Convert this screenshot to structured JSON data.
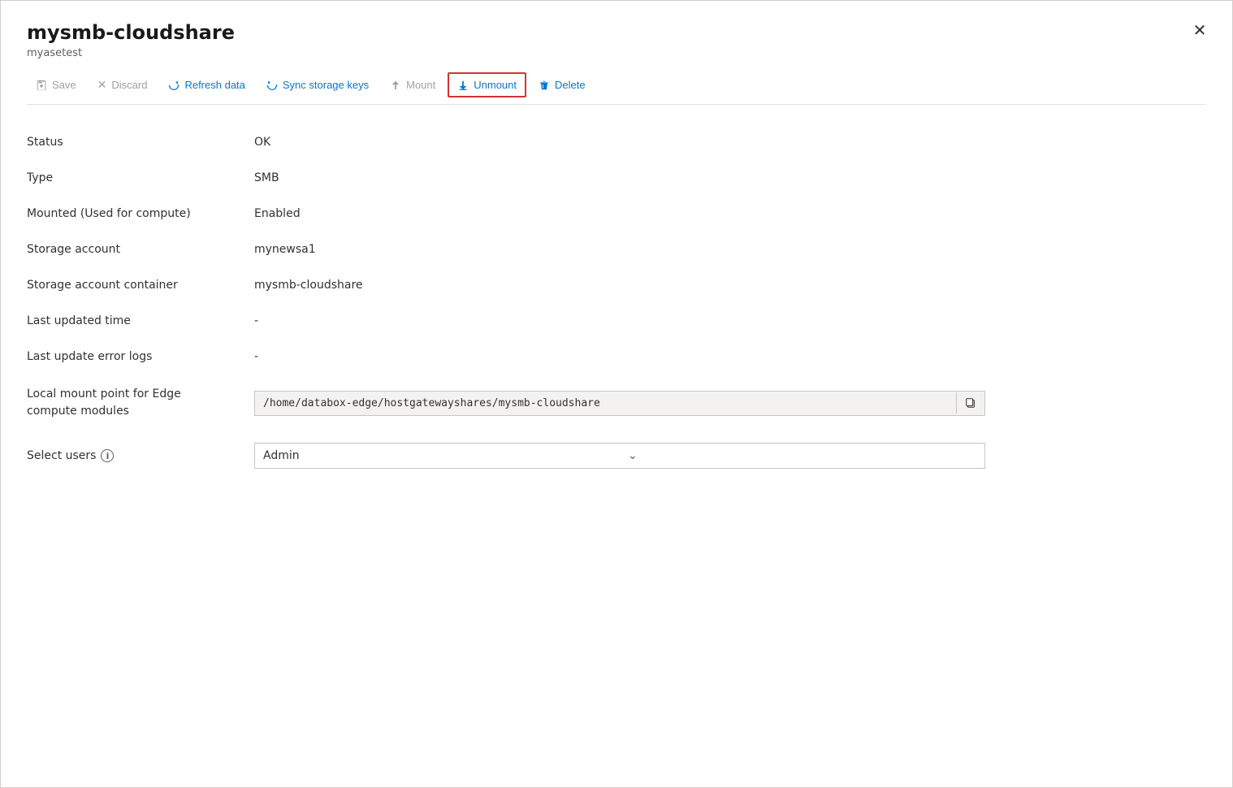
{
  "panel": {
    "title": "mysmb-cloudshare",
    "subtitle": "myasetest",
    "close_label": "✕"
  },
  "toolbar": {
    "save_label": "Save",
    "discard_label": "Discard",
    "refresh_label": "Refresh data",
    "sync_label": "Sync storage keys",
    "mount_label": "Mount",
    "unmount_label": "Unmount",
    "delete_label": "Delete"
  },
  "fields": [
    {
      "label": "Status",
      "value": "OK",
      "type": "text"
    },
    {
      "label": "Type",
      "value": "SMB",
      "type": "text"
    },
    {
      "label": "Mounted (Used for compute)",
      "value": "Enabled",
      "type": "text"
    },
    {
      "label": "Storage account",
      "value": "mynewsa1",
      "type": "text"
    },
    {
      "label": "Storage account container",
      "value": "mysmb-cloudshare",
      "type": "text"
    },
    {
      "label": "Last updated time",
      "value": "-",
      "type": "text"
    },
    {
      "label": "Last update error logs",
      "value": "-",
      "type": "text"
    },
    {
      "label": "Local mount point for Edge compute modules",
      "value": "/home/databox-edge/hostgatewayshares/mysmb-cloudshare",
      "type": "copy"
    },
    {
      "label": "Select users",
      "value": "Admin",
      "type": "select",
      "has_info": true
    }
  ],
  "colors": {
    "accent_blue": "#0078d4",
    "highlight_red": "#d13438",
    "disabled_gray": "#a19f9d",
    "border": "#c8c6c4",
    "bg_light": "#f3f2f1"
  }
}
